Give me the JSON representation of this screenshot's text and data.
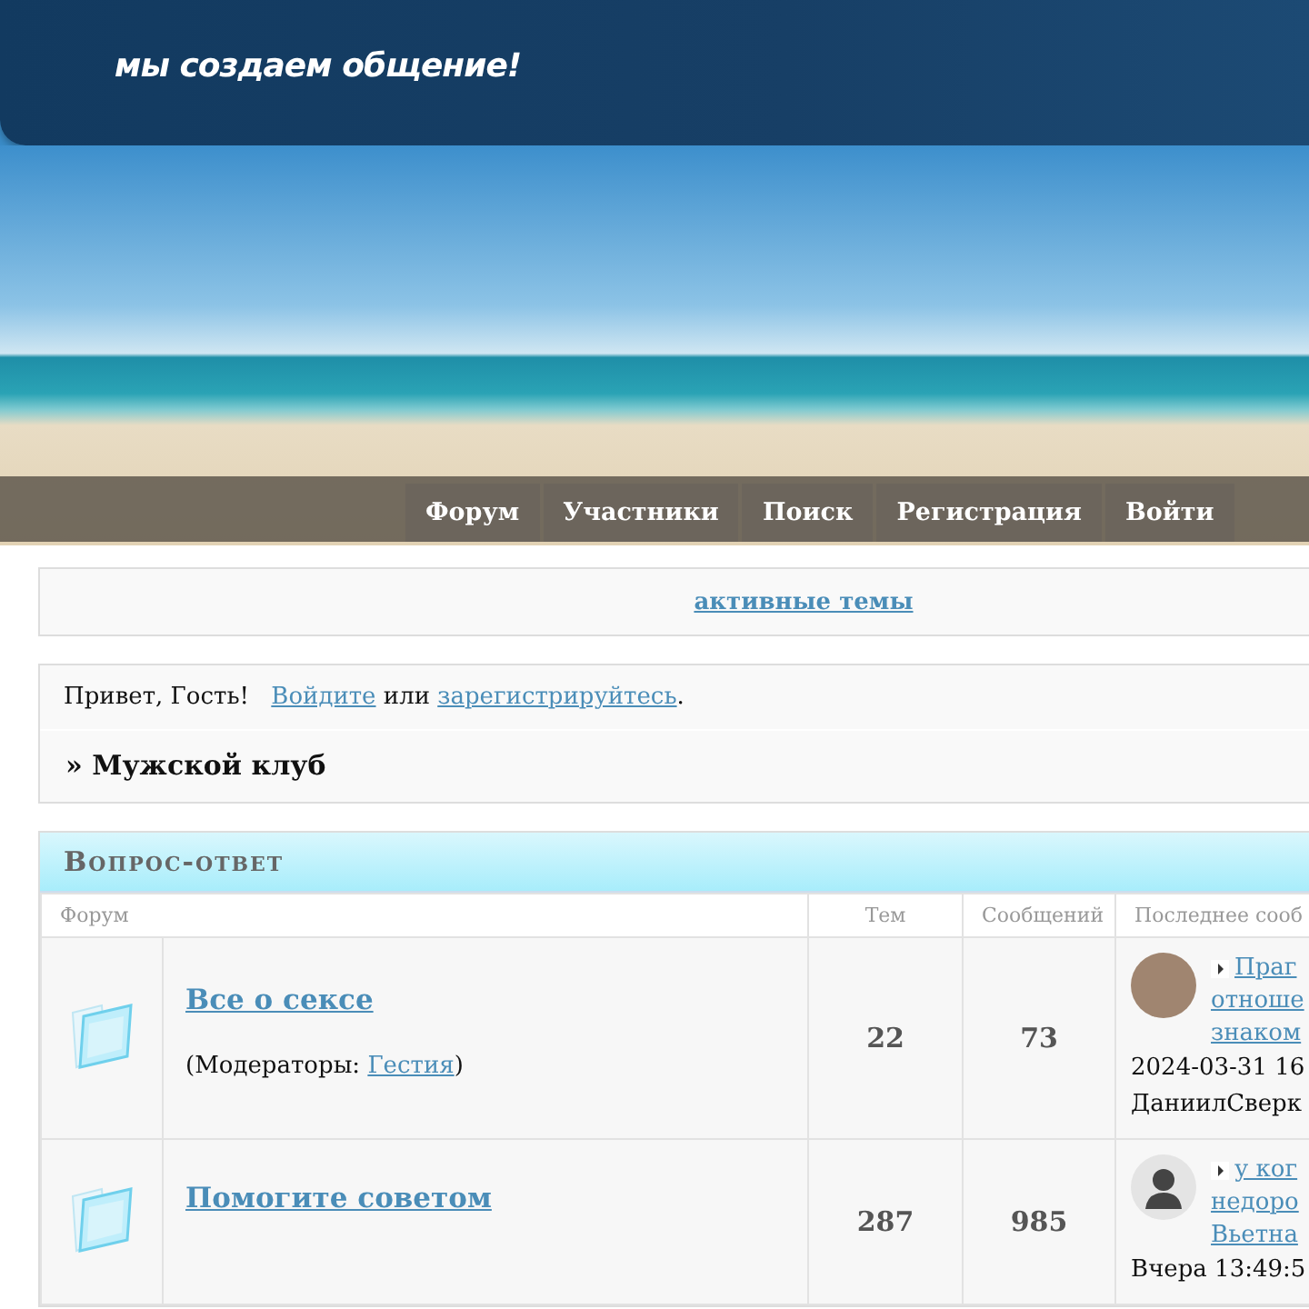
{
  "header": {
    "slogan": "мы создаем общение!"
  },
  "nav": [
    {
      "label": "Форум"
    },
    {
      "label": "Участники"
    },
    {
      "label": "Поиск"
    },
    {
      "label": "Регистрация"
    },
    {
      "label": "Войти"
    }
  ],
  "active_topics_link": "активные темы",
  "welcome": {
    "greeting": "Привет, Гость!",
    "login_link": "Войдите",
    "or_text": "или",
    "register_link": "зарегистрируйтесь",
    "end": "."
  },
  "breadcrumb": "» Мужской клуб",
  "category": {
    "title": "Вопрос-ответ",
    "columns": [
      "Форум",
      "Тем",
      "Сообщений",
      "Последнее сооб"
    ],
    "forums": [
      {
        "title": "Все о сексе",
        "moderators_label": "(Модераторы:",
        "moderators": [
          "Гестия"
        ],
        "moderators_end": ")",
        "topics": "22",
        "posts": "73",
        "last_post": {
          "kind": "photo",
          "topic_lines": [
            "Праг",
            "отноше",
            "знаком"
          ],
          "time": "2024-03-31 16",
          "author": "ДаниилСверк"
        }
      },
      {
        "title": "Помогите советом",
        "topics": "287",
        "posts": "985",
        "last_post": {
          "kind": "silhouette",
          "topic_lines": [
            "у ког",
            "недоро",
            "Вьетна"
          ],
          "time": "Вчера 13:49:5"
        }
      }
    ]
  }
}
